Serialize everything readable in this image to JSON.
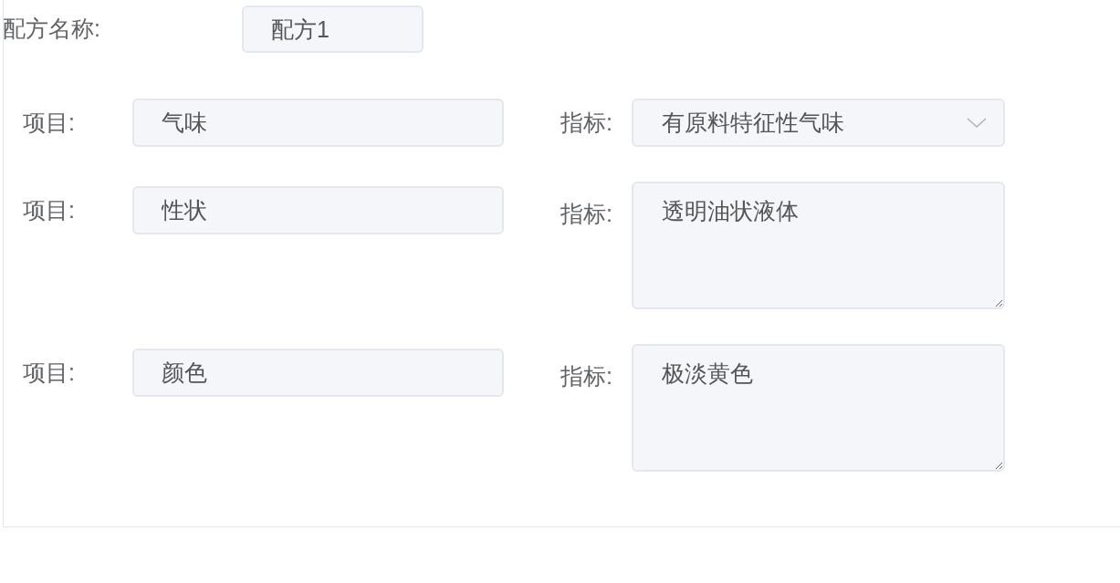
{
  "recipe_name": {
    "label": "配方名称:",
    "value": "配方1"
  },
  "rows": [
    {
      "item_label": "项目:",
      "item_value": "气味",
      "indicator_label": "指标:",
      "indicator": {
        "kind": "select",
        "value": "有原料特征性气味"
      }
    },
    {
      "item_label": "项目:",
      "item_value": "性状",
      "indicator_label": "指标:",
      "indicator": {
        "kind": "textarea",
        "value": "透明油状液体"
      }
    },
    {
      "item_label": "项目:",
      "item_value": "颜色",
      "indicator_label": "指标:",
      "indicator": {
        "kind": "textarea",
        "value": "极淡黄色"
      }
    }
  ]
}
